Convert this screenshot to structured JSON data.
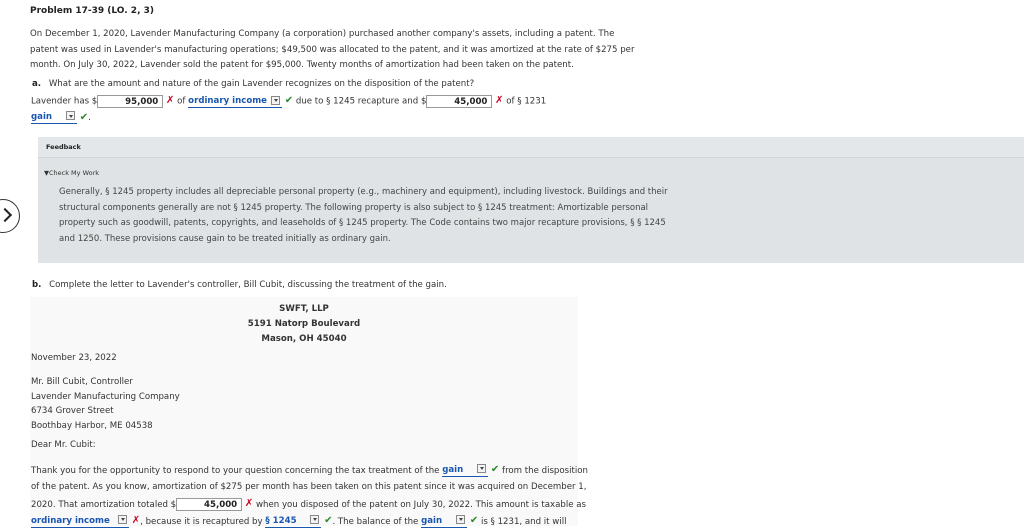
{
  "problem_title": "Problem 17-39 (LO. 2, 3)",
  "intro": {
    "line1": "On December 1, 2020, Lavender Manufacturing Company (a corporation) purchased another company's assets, including a patent. The",
    "line2": "patent was used in Lavender's manufacturing operations; $49,500 was allocated to the patent, and it was amortized at the rate of $275 per",
    "line3": "month. On July 30, 2022, Lavender sold the patent for $95,000. Twenty months of amortization had been taken on the patent."
  },
  "part_a": {
    "letter": "a.",
    "question": "What are the amount and nature of the gain Lavender recognizes on the disposition of the patent?",
    "text1": "Lavender has $",
    "value1": "95,000",
    "text2": "of",
    "select1": "ordinary income",
    "text3": "due to § 1245 recapture and $",
    "value2": "45,000",
    "text4": "of § 1231",
    "select2": "gain",
    "text5": "."
  },
  "feedback": {
    "label": "Feedback",
    "toggle": "Check My Work",
    "lines": [
      "Generally, § 1245 property includes all depreciable personal property (e.g., machinery and equipment), including livestock. Buildings and their",
      "structural components generally are not § 1245 property. The following property is also subject to § 1245 treatment: Amortizable personal",
      "property such as goodwill, patents, copyrights, and leaseholds of § 1245 property. The Code contains two major recapture provisions, § § 1245",
      "and 1250. These provisions cause gain to be treated initially as ordinary gain."
    ]
  },
  "part_b": {
    "letter": "b.",
    "question": "Complete the letter to Lavender's controller, Bill Cubit, discussing the treatment of the gain."
  },
  "letter": {
    "firm": "SWFT, LLP",
    "street": "5191 Natorp Boulevard",
    "city": "Mason, OH 45040",
    "date": "November 23, 2022",
    "recipient": [
      "Mr. Bill Cubit, Controller",
      "Lavender Manufacturing Company",
      "6734 Grover Street",
      "Boothbay Harbor, ME 04538"
    ],
    "salutation": "Dear Mr. Cubit:",
    "body": {
      "l1a": "Thank you for the opportunity to respond to your question concerning the tax treatment of the",
      "sel1": "gain",
      "l1b": "from the disposition",
      "l2": "of the patent. As you know, amortization of $275 per month has been taken on this patent since it was acquired on December 1,",
      "l3a": "2020. That amortization totaled $",
      "val1": "45,000",
      "l3b": "when you disposed of the patent on July 30, 2022. This amount is taxable as",
      "sel2": "ordinary income",
      "l4a": ", because it is recaptured by",
      "sel3": "§ 1245",
      "l4b": ". The balance of the",
      "sel4": "gain",
      "l4c": "is § 1231, and it will"
    }
  },
  "colors": {
    "link": "#1a56b0",
    "correct": "#2a8a2a",
    "incorrect": "#c8001e",
    "feedback_bg": "#e3e7e9"
  },
  "icons": {
    "correct": "check-icon",
    "incorrect": "x-icon",
    "nav": "chevron-right-icon",
    "dropdown": "chevron-down-icon"
  }
}
